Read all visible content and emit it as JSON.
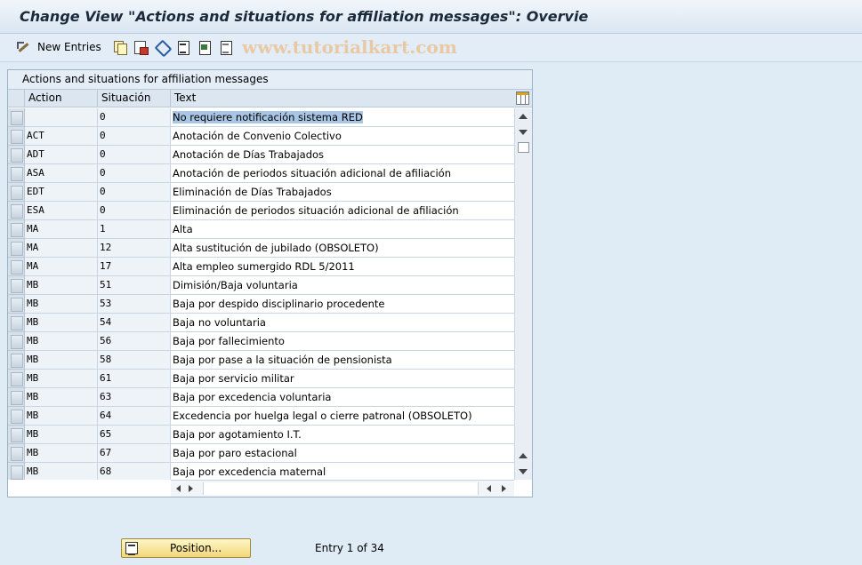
{
  "window": {
    "title": "Change View \"Actions and situations for affiliation messages\": Overvie"
  },
  "toolbar": {
    "new_entries_label": "New Entries",
    "icons": [
      "pencil-icon",
      "copy-icon",
      "delete-icon",
      "undo-icon",
      "select-all-icon",
      "select-block-icon",
      "deselect-all-icon"
    ],
    "watermark": "www.tutorialkart.com"
  },
  "table": {
    "title": "Actions and situations for affiliation messages",
    "columns": {
      "action": "Action",
      "situacion": "Situación",
      "text": "Text"
    },
    "rows": [
      {
        "action": "",
        "situacion": "0",
        "text": "No requiere notificación sistema RED",
        "highlight": true
      },
      {
        "action": "ACT",
        "situacion": "0",
        "text": "Anotación de Convenio Colectivo"
      },
      {
        "action": "ADT",
        "situacion": "0",
        "text": "Anotación de Días Trabajados"
      },
      {
        "action": "ASA",
        "situacion": "0",
        "text": "Anotación de periodos situación adicional de afiliación"
      },
      {
        "action": "EDT",
        "situacion": "0",
        "text": "Eliminación de Días Trabajados"
      },
      {
        "action": "ESA",
        "situacion": "0",
        "text": "Eliminación de periodos situación adicional de afiliación"
      },
      {
        "action": "MA",
        "situacion": "1",
        "text": "Alta"
      },
      {
        "action": "MA",
        "situacion": "12",
        "text": "Alta sustitución de jubilado (OBSOLETO)"
      },
      {
        "action": "MA",
        "situacion": "17",
        "text": "Alta empleo sumergido RDL 5/2011"
      },
      {
        "action": "MB",
        "situacion": "51",
        "text": "Dimisión/Baja voluntaria"
      },
      {
        "action": "MB",
        "situacion": "53",
        "text": "Baja por despido disciplinario procedente"
      },
      {
        "action": "MB",
        "situacion": "54",
        "text": "Baja no voluntaria"
      },
      {
        "action": "MB",
        "situacion": "56",
        "text": "Baja por fallecimiento"
      },
      {
        "action": "MB",
        "situacion": "58",
        "text": "Baja por pase a la situación de pensionista"
      },
      {
        "action": "MB",
        "situacion": "61",
        "text": "Baja por servicio militar"
      },
      {
        "action": "MB",
        "situacion": "63",
        "text": "Baja por excedencia voluntaria"
      },
      {
        "action": "MB",
        "situacion": "64",
        "text": "Excedencia por huelga legal o cierre patronal (OBSOLETO)"
      },
      {
        "action": "MB",
        "situacion": "65",
        "text": "Baja por agotamiento I.T."
      },
      {
        "action": "MB",
        "situacion": "67",
        "text": "Baja por paro estacional"
      },
      {
        "action": "MB",
        "situacion": "68",
        "text": "Baja por excedencia maternal"
      }
    ]
  },
  "footer": {
    "position_button": "Position...",
    "entry_info": "Entry 1 of 34"
  },
  "colors": {
    "highlight": "#a9c6e6",
    "button_bg": "#f1d77a",
    "background": "#dfebf5"
  }
}
